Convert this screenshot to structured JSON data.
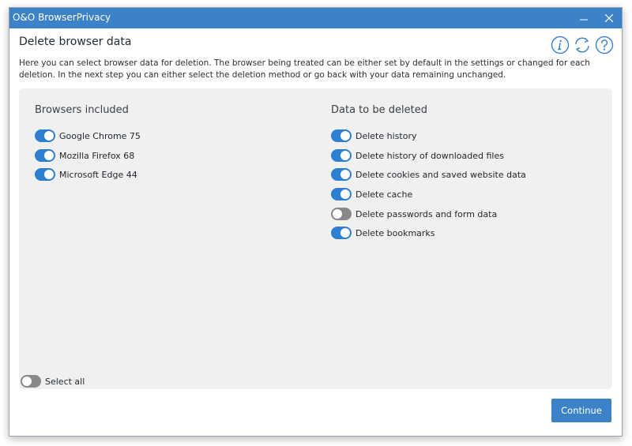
{
  "window": {
    "title": "O&O BrowserPrivacy",
    "minimize_label": "—",
    "close_label": "✕"
  },
  "header": {
    "title": "Delete browser data",
    "icons": [
      "info-icon",
      "refresh-icon",
      "help-icon"
    ]
  },
  "description": "Here you can select browser data for deletion. The browser being treated can be either set by default in the settings or changed for each deletion. In the next step you can either select the deletion method or go back with your data remaining unchanged.",
  "browsers": {
    "title": "Browsers included",
    "items": [
      {
        "label": "Google Chrome 75",
        "on": true
      },
      {
        "label": "Mozilla Firefox 68",
        "on": true
      },
      {
        "label": "Microsoft Edge 44",
        "on": true
      }
    ]
  },
  "data_to_delete": {
    "title": "Data to be deleted",
    "items": [
      {
        "label": "Delete history",
        "on": true
      },
      {
        "label": "Delete history of downloaded files",
        "on": true
      },
      {
        "label": "Delete cookies and saved website data",
        "on": true
      },
      {
        "label": "Delete cache",
        "on": true
      },
      {
        "label": "Delete passwords and form data",
        "on": false
      },
      {
        "label": "Delete bookmarks",
        "on": true
      }
    ]
  },
  "select_all": {
    "label": "Select all",
    "on": false
  },
  "footer": {
    "continue_label": "Continue"
  },
  "colors": {
    "accent": "#3b82c8",
    "toggle_on": "#2e7fd1",
    "toggle_off": "#888888",
    "panel_bg": "#f0f0f0"
  }
}
